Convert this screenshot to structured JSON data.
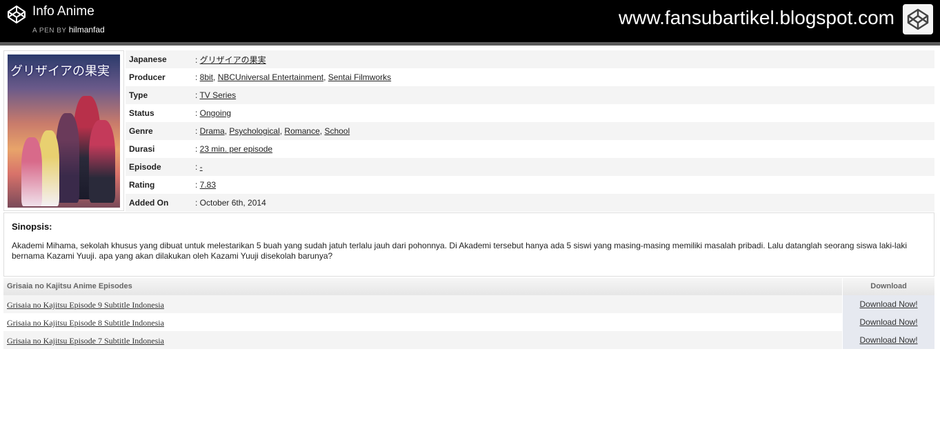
{
  "header": {
    "pen_title": "Info Anime",
    "pen_by": "A PEN BY",
    "author": "hilmanfad",
    "site_url": "www.fansubartikel.blogspot.com"
  },
  "cover": {
    "title_text": "グリザイアの果実"
  },
  "info": [
    {
      "label": "Japanese",
      "values": [
        "グリザイアの果実"
      ]
    },
    {
      "label": "Producer",
      "values": [
        "8bit",
        "NBCUniversal Entertainment",
        "Sentai Filmworks"
      ]
    },
    {
      "label": "Type",
      "values": [
        "TV Series"
      ]
    },
    {
      "label": "Status",
      "values": [
        "Ongoing"
      ]
    },
    {
      "label": "Genre",
      "values": [
        "Drama",
        "Psychological",
        "Romance",
        "School"
      ]
    },
    {
      "label": "Durasi",
      "values": [
        "23 min. per episode"
      ]
    },
    {
      "label": "Episode",
      "values": [
        "-"
      ]
    },
    {
      "label": "Rating",
      "values": [
        "7.83"
      ]
    },
    {
      "label": "Added On",
      "values": [
        "October 6th, 2014"
      ],
      "plain": true
    }
  ],
  "synopsis": {
    "title": "Sinopsis:",
    "text": "Akademi Mihama, sekolah khusus yang dibuat untuk melestarikan 5 buah yang sudah jatuh terlalu jauh dari pohonnya. Di Akademi tersebut hanya ada 5 siswi yang masing-masing memiliki masalah pribadi. Lalu datanglah seorang siswa laki-laki bernama Kazami Yuuji. apa yang akan dilakukan oleh Kazami Yuuji disekolah barunya?"
  },
  "episodes": {
    "header_title": "Grisaia no Kajitsu Anime Episodes",
    "header_download": "Download",
    "rows": [
      {
        "title": "Grisaia no Kajitsu Episode 9 Subtitle Indonesia",
        "download": "Download Now!"
      },
      {
        "title": "Grisaia no Kajitsu Episode 8 Subtitle Indonesia",
        "download": "Download Now!"
      },
      {
        "title": "Grisaia no Kajitsu Episode 7 Subtitle Indonesia",
        "download": "Download Now!"
      }
    ]
  }
}
